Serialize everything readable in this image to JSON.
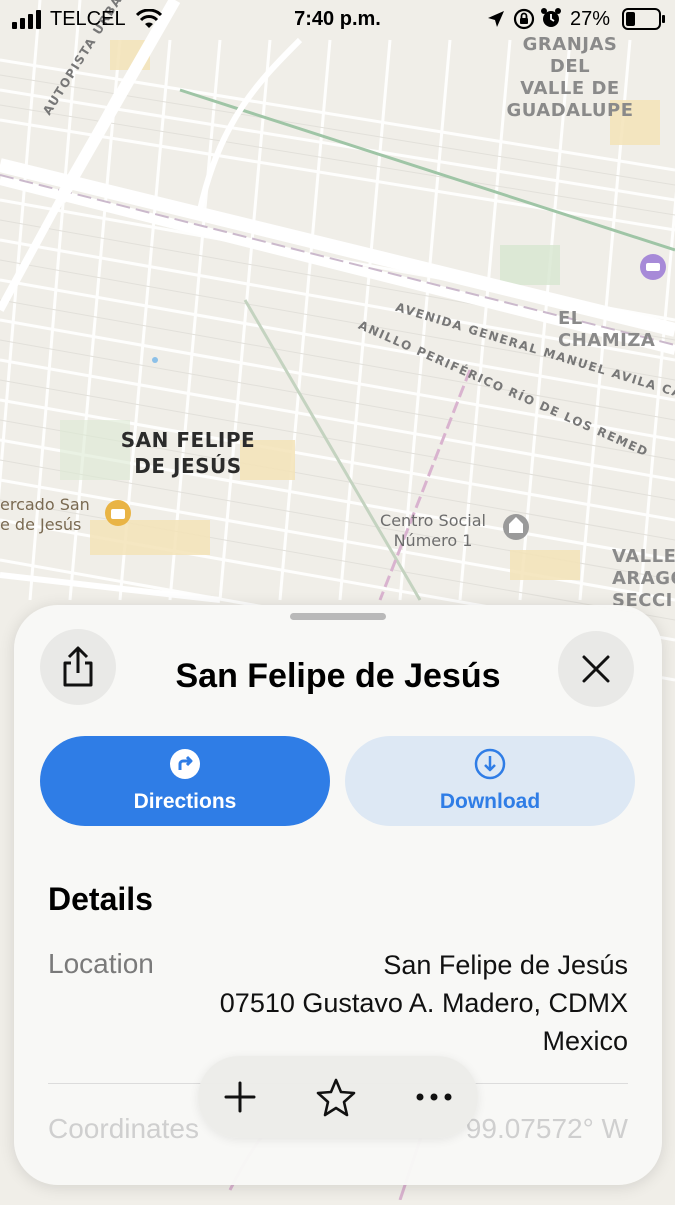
{
  "status_bar": {
    "carrier": "TELCEL",
    "time": "7:40 p.m.",
    "battery": "27%"
  },
  "map": {
    "labels": {
      "granjas": "GRANJAS DEL VALLE DE GUADALUPE",
      "granjas_l1": "GRANJAS DEL",
      "granjas_l2": "VALLE DE",
      "granjas_l3": "GUADALUPE",
      "autopista": "AUTOPISTA URBANA SIE",
      "el_chamizal": "EL CHAMIZA",
      "avenida": "AVENIDA GENERAL MANUEL AVILA CA",
      "anillo": "ANILLO PERIFÉRICO RÍO DE LOS REMED",
      "san_felipe_l1": "SAN FELIPE",
      "san_felipe_l2": "DE JESÚS",
      "mercado_l1": "ercado San",
      "mercado_l2": "e de Jesús",
      "centro_l1": "Centro Social",
      "centro_l2": "Número 1",
      "valle_l1": "VALLE",
      "valle_l2": "ARAGÓN",
      "valle_l3": "SECCI"
    }
  },
  "sheet": {
    "title": "San Felipe de Jesús",
    "directions_label": "Directions",
    "download_label": "Download",
    "details_heading": "Details",
    "location_label": "Location",
    "location_line1": "San Felipe de Jesús",
    "location_line2": "07510 Gustavo A. Madero, CDMX",
    "location_line3": "Mexico",
    "coordinates_label": "Coordinates",
    "coordinates_value": "99.07572° W"
  },
  "colors": {
    "accent": "#2f7de6",
    "download_bg": "#dde8f4",
    "download_text": "#2f7de6"
  }
}
